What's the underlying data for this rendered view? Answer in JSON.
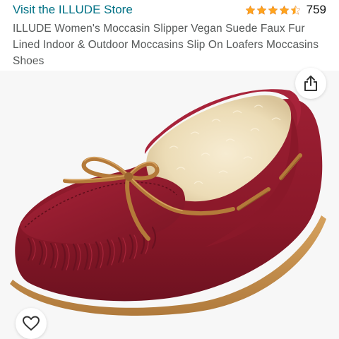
{
  "store": {
    "link_label": "Visit the ILLUDE Store"
  },
  "rating": {
    "stars": 4.5,
    "count": "759",
    "star_color": "#ffa41c"
  },
  "product": {
    "title": "ILLUDE Women's Moccasin Slipper Vegan Suede Faux Fur Lined Indoor & Outdoor Moccasins Slip On Loafers Moccasins Shoes",
    "image_icon": "wine-red-moccasin-slipper-image"
  },
  "actions": {
    "share_icon": "share-icon",
    "wishlist_icon": "heart-icon"
  },
  "colors": {
    "link": "#007185",
    "text": "#565959",
    "suede": "#8e1a2c",
    "fur": "#f3e4c4",
    "lace": "#b47a3a"
  }
}
